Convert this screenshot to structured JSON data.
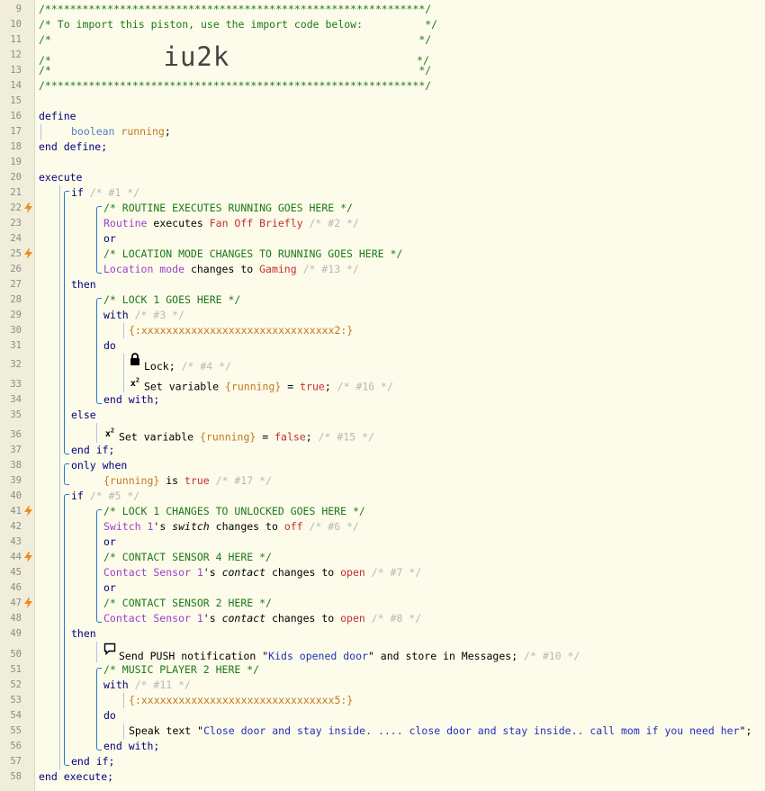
{
  "lines": [
    {
      "n": "9",
      "bolt": false,
      "indent": 0,
      "parts": [
        {
          "t": "/*************************************************************/",
          "c": "c"
        }
      ]
    },
    {
      "n": "10",
      "bolt": false,
      "indent": 0,
      "parts": [
        {
          "t": "/* To import this piston, use the import code below:          */",
          "c": "c"
        }
      ]
    },
    {
      "n": "11",
      "bolt": false,
      "indent": 0,
      "parts": [
        {
          "t": "/*                                                           */",
          "c": "c"
        }
      ]
    },
    {
      "n": "12",
      "bolt": false,
      "indent": 0,
      "parts": [
        {
          "t": "/*",
          "c": "c"
        },
        {
          "t": "                  ",
          "c": ""
        },
        {
          "t": "iu2k",
          "c": "big"
        },
        {
          "t": "                              */",
          "c": "c"
        }
      ]
    },
    {
      "n": "13",
      "bolt": false,
      "indent": 0,
      "parts": [
        {
          "t": "/*                                                           */",
          "c": "c"
        }
      ]
    },
    {
      "n": "14",
      "bolt": false,
      "indent": 0,
      "parts": [
        {
          "t": "/*************************************************************/",
          "c": "c"
        }
      ]
    },
    {
      "n": "15",
      "bolt": false,
      "indent": 0,
      "parts": []
    },
    {
      "n": "16",
      "bolt": false,
      "indent": 0,
      "parts": [
        {
          "t": "define",
          "c": "kw"
        }
      ]
    },
    {
      "n": "17",
      "bolt": false,
      "indent": 1,
      "parts": [
        {
          "t": "boolean ",
          "c": "ty"
        },
        {
          "t": "running",
          "c": "var"
        },
        {
          "t": ";",
          "c": ""
        }
      ]
    },
    {
      "n": "18",
      "bolt": false,
      "indent": 0,
      "parts": [
        {
          "t": "end define;",
          "c": "kw"
        }
      ]
    },
    {
      "n": "19",
      "bolt": false,
      "indent": 0,
      "parts": []
    },
    {
      "n": "20",
      "bolt": false,
      "indent": 0,
      "parts": [
        {
          "t": "execute",
          "c": "kw"
        }
      ]
    },
    {
      "n": "21",
      "bolt": false,
      "indent": 1,
      "parts": [
        {
          "t": "if ",
          "c": "kw"
        },
        {
          "t": "/* #1 */",
          "c": "g"
        }
      ]
    },
    {
      "n": "22",
      "bolt": true,
      "indent": 2,
      "parts": [
        {
          "t": "/* ROUTINE EXECUTES RUNNING GOES HERE */",
          "c": "c"
        }
      ]
    },
    {
      "n": "23",
      "bolt": false,
      "indent": 2,
      "parts": [
        {
          "t": "Routine",
          "c": "dev"
        },
        {
          "t": " executes ",
          "c": ""
        },
        {
          "t": "Fan Off Briefly",
          "c": "val"
        },
        {
          "t": " /* #2 */",
          "c": "g"
        }
      ]
    },
    {
      "n": "24",
      "bolt": false,
      "indent": 2,
      "parts": [
        {
          "t": "or",
          "c": "kw"
        }
      ]
    },
    {
      "n": "25",
      "bolt": true,
      "indent": 2,
      "parts": [
        {
          "t": "/* LOCATION MODE CHANGES TO RUNNING GOES HERE */",
          "c": "c"
        }
      ]
    },
    {
      "n": "26",
      "bolt": false,
      "indent": 2,
      "parts": [
        {
          "t": "Location mode",
          "c": "dev"
        },
        {
          "t": " changes to ",
          "c": ""
        },
        {
          "t": "Gaming",
          "c": "val"
        },
        {
          "t": " /* #13 */",
          "c": "g"
        }
      ]
    },
    {
      "n": "27",
      "bolt": false,
      "indent": 1,
      "parts": [
        {
          "t": "then",
          "c": "kw"
        }
      ]
    },
    {
      "n": "28",
      "bolt": false,
      "indent": 2,
      "parts": [
        {
          "t": "/* LOCK 1 GOES HERE */",
          "c": "c"
        }
      ]
    },
    {
      "n": "29",
      "bolt": false,
      "indent": 2,
      "parts": [
        {
          "t": "with",
          "c": "kw"
        },
        {
          "t": " /* #3 */",
          "c": "g"
        }
      ]
    },
    {
      "n": "30",
      "bolt": false,
      "indent": 3,
      "parts": [
        {
          "t": "{:xxxxxxxxxxxxxxxxxxxxxxxxxxxxxxx2:}",
          "c": "var"
        }
      ]
    },
    {
      "n": "31",
      "bolt": false,
      "indent": 2,
      "parts": [
        {
          "t": "do",
          "c": "kw"
        }
      ]
    },
    {
      "n": "32",
      "bolt": false,
      "indent": 3,
      "icon": "lock",
      "parts": [
        {
          "t": "Lock;",
          "c": ""
        },
        {
          "t": " /* #4 */",
          "c": "g"
        }
      ]
    },
    {
      "n": "33",
      "bolt": false,
      "indent": 3,
      "icon": "x2",
      "parts": [
        {
          "t": "Set variable ",
          "c": ""
        },
        {
          "t": "{running}",
          "c": "var"
        },
        {
          "t": " = ",
          "c": ""
        },
        {
          "t": "true",
          "c": "val"
        },
        {
          "t": ";",
          "c": ""
        },
        {
          "t": " /* #16 */",
          "c": "g"
        }
      ]
    },
    {
      "n": "34",
      "bolt": false,
      "indent": 2,
      "parts": [
        {
          "t": "end with;",
          "c": "kw"
        }
      ]
    },
    {
      "n": "35",
      "bolt": false,
      "indent": 1,
      "parts": [
        {
          "t": "else",
          "c": "kw"
        }
      ]
    },
    {
      "n": "36",
      "bolt": false,
      "indent": 2,
      "icon": "x2",
      "parts": [
        {
          "t": "Set variable ",
          "c": ""
        },
        {
          "t": "{running}",
          "c": "var"
        },
        {
          "t": " = ",
          "c": ""
        },
        {
          "t": "false",
          "c": "val"
        },
        {
          "t": ";",
          "c": ""
        },
        {
          "t": " /* #15 */",
          "c": "g"
        }
      ]
    },
    {
      "n": "37",
      "bolt": false,
      "indent": 1,
      "parts": [
        {
          "t": "end if;",
          "c": "kw"
        }
      ]
    },
    {
      "n": "38",
      "bolt": false,
      "indent": 1,
      "parts": [
        {
          "t": "only when",
          "c": "kw"
        }
      ]
    },
    {
      "n": "39",
      "bolt": false,
      "indent": 2,
      "parts": [
        {
          "t": "{running}",
          "c": "var"
        },
        {
          "t": " is ",
          "c": ""
        },
        {
          "t": "true",
          "c": "val"
        },
        {
          "t": " /* #17 */",
          "c": "g"
        }
      ]
    },
    {
      "n": "40",
      "bolt": false,
      "indent": 1,
      "parts": [
        {
          "t": "if ",
          "c": "kw"
        },
        {
          "t": "/* #5 */",
          "c": "g"
        }
      ]
    },
    {
      "n": "41",
      "bolt": true,
      "indent": 2,
      "parts": [
        {
          "t": "/* LOCK 1 CHANGES TO UNLOCKED GOES HERE */",
          "c": "c"
        }
      ]
    },
    {
      "n": "42",
      "bolt": false,
      "indent": 2,
      "parts": [
        {
          "t": "Switch 1",
          "c": "dev"
        },
        {
          "t": "'s ",
          "c": ""
        },
        {
          "t": "switch",
          "c": "attr"
        },
        {
          "t": " changes to ",
          "c": ""
        },
        {
          "t": "off",
          "c": "val"
        },
        {
          "t": " /* #6 */",
          "c": "g"
        }
      ]
    },
    {
      "n": "43",
      "bolt": false,
      "indent": 2,
      "parts": [
        {
          "t": "or",
          "c": "kw"
        }
      ]
    },
    {
      "n": "44",
      "bolt": true,
      "indent": 2,
      "parts": [
        {
          "t": "/* CONTACT SENSOR 4 HERE */",
          "c": "c"
        }
      ]
    },
    {
      "n": "45",
      "bolt": false,
      "indent": 2,
      "parts": [
        {
          "t": "Contact Sensor 1",
          "c": "dev"
        },
        {
          "t": "'s ",
          "c": ""
        },
        {
          "t": "contact",
          "c": "attr"
        },
        {
          "t": " changes to ",
          "c": ""
        },
        {
          "t": "open",
          "c": "val"
        },
        {
          "t": " /* #7 */",
          "c": "g"
        }
      ]
    },
    {
      "n": "46",
      "bolt": false,
      "indent": 2,
      "parts": [
        {
          "t": "or",
          "c": "kw"
        }
      ]
    },
    {
      "n": "47",
      "bolt": true,
      "indent": 2,
      "parts": [
        {
          "t": "/* CONTACT SENSOR 2 HERE */",
          "c": "c"
        }
      ]
    },
    {
      "n": "48",
      "bolt": false,
      "indent": 2,
      "parts": [
        {
          "t": "Contact Sensor 1",
          "c": "dev"
        },
        {
          "t": "'s ",
          "c": ""
        },
        {
          "t": "contact",
          "c": "attr"
        },
        {
          "t": " changes to ",
          "c": ""
        },
        {
          "t": "open",
          "c": "val"
        },
        {
          "t": " /* #8 */",
          "c": "g"
        }
      ]
    },
    {
      "n": "49",
      "bolt": false,
      "indent": 1,
      "parts": [
        {
          "t": "then",
          "c": "kw"
        }
      ]
    },
    {
      "n": "50",
      "bolt": false,
      "indent": 2,
      "icon": "msg",
      "parts": [
        {
          "t": "Send PUSH notification \"",
          "c": ""
        },
        {
          "t": "Kids opened door",
          "c": "str"
        },
        {
          "t": "\" and store in Messages;",
          "c": ""
        },
        {
          "t": " /* #10 */",
          "c": "g"
        }
      ]
    },
    {
      "n": "51",
      "bolt": false,
      "indent": 2,
      "parts": [
        {
          "t": "/* MUSIC PLAYER 2 HERE */",
          "c": "c"
        }
      ]
    },
    {
      "n": "52",
      "bolt": false,
      "indent": 2,
      "parts": [
        {
          "t": "with",
          "c": "kw"
        },
        {
          "t": " /* #11 */",
          "c": "g"
        }
      ]
    },
    {
      "n": "53",
      "bolt": false,
      "indent": 3,
      "parts": [
        {
          "t": "{:xxxxxxxxxxxxxxxxxxxxxxxxxxxxxxx5:}",
          "c": "var"
        }
      ]
    },
    {
      "n": "54",
      "bolt": false,
      "indent": 2,
      "parts": [
        {
          "t": "do",
          "c": "kw"
        }
      ]
    },
    {
      "n": "55",
      "bolt": false,
      "indent": 3,
      "parts": [
        {
          "t": "Speak text \"",
          "c": ""
        },
        {
          "t": "Close door and stay inside. .... close door and stay inside.. call mom if you need her",
          "c": "str"
        },
        {
          "t": "\";",
          "c": ""
        }
      ]
    },
    {
      "n": "56",
      "bolt": false,
      "indent": 2,
      "parts": [
        {
          "t": "end with;",
          "c": "kw"
        }
      ]
    },
    {
      "n": "57",
      "bolt": false,
      "indent": 1,
      "parts": [
        {
          "t": "end if;",
          "c": "kw"
        }
      ]
    },
    {
      "n": "58",
      "bolt": false,
      "indent": 0,
      "parts": [
        {
          "t": "end execute;",
          "c": "kw"
        }
      ]
    }
  ],
  "icons": {
    "bolt": "lightning-bolt-icon",
    "lock": "lock-icon",
    "x2": "variable-x2-icon",
    "msg": "message-bubble-icon"
  },
  "colors": {
    "comment": "#1a7a1a",
    "keyword": "#000080",
    "device": "#9a3fd0",
    "value": "#c03030",
    "variable": "#c07820",
    "string": "#2030c0",
    "bolt": "#f08a1c",
    "background": "#fdfbe9"
  }
}
